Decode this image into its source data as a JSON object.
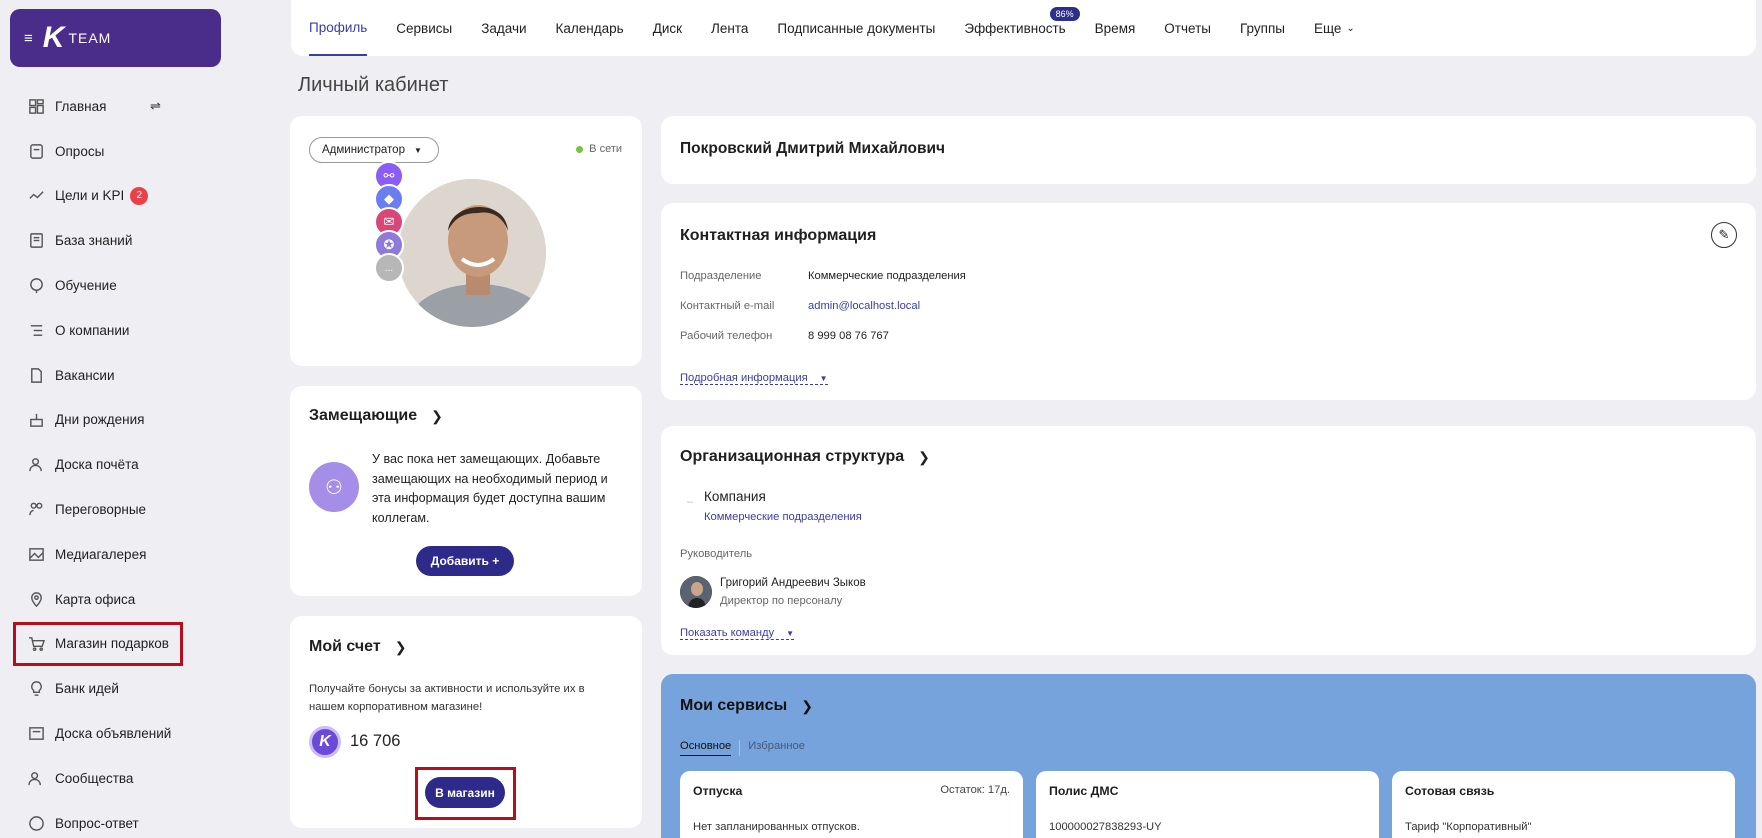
{
  "brand": {
    "text": "TEAM",
    "logo": "K"
  },
  "sidebar": {
    "items": [
      {
        "label": "Главная",
        "icon": "dashboard-icon"
      },
      {
        "label": "Опросы",
        "icon": "survey-icon"
      },
      {
        "label": "Цели и KPI",
        "icon": "kpi-icon",
        "badge": "2"
      },
      {
        "label": "База знаний",
        "icon": "book-icon"
      },
      {
        "label": "Обучение",
        "icon": "education-icon"
      },
      {
        "label": "О компании",
        "icon": "company-icon"
      },
      {
        "label": "Вакансии",
        "icon": "vacancy-icon"
      },
      {
        "label": "Дни рождения",
        "icon": "birthday-icon"
      },
      {
        "label": "Доска почёта",
        "icon": "honor-board-icon"
      },
      {
        "label": "Переговорные",
        "icon": "meeting-room-icon"
      },
      {
        "label": "Медиагалерея",
        "icon": "gallery-icon"
      },
      {
        "label": "Карта офиса",
        "icon": "map-pin-icon"
      },
      {
        "label": "Магазин подарков",
        "icon": "cart-icon"
      },
      {
        "label": "Банк идей",
        "icon": "lightbulb-icon"
      },
      {
        "label": "Доска объявлений",
        "icon": "announcement-icon"
      },
      {
        "label": "Сообщества",
        "icon": "community-icon"
      },
      {
        "label": "Вопрос-ответ",
        "icon": "faq-icon"
      }
    ]
  },
  "topnav": {
    "tabs": [
      "Профиль",
      "Сервисы",
      "Задачи",
      "Календарь",
      "Диск",
      "Лента",
      "Подписанные документы",
      "Эффективность",
      "Время",
      "Отчеты",
      "Группы",
      "Еще"
    ],
    "efficiency_badge": "86%"
  },
  "page_title": "Личный кабинет",
  "profile": {
    "role": "Администратор",
    "status": "В сети",
    "more": "..."
  },
  "name": "Покровский Дмитрий Михайлович",
  "contact": {
    "title": "Контактная информация",
    "rows": [
      {
        "label": "Подразделение",
        "value": "Коммерческие подразделения"
      },
      {
        "label": "Контактный e-mail",
        "value": "admin@localhost.local"
      },
      {
        "label": "Рабочий телефон",
        "value": "8 999 08 76 767"
      }
    ],
    "more": "Подробная информация"
  },
  "substitutes": {
    "title": "Замещающие",
    "text": "У вас пока нет замещающих. Добавьте замещающих на необходимый период и эта информация будет доступна вашим коллегам.",
    "button": "Добавить  +"
  },
  "account": {
    "title": "Мой счет",
    "text": "Получайте бонусы за активности и используйте их в нашем корпоративном магазине!",
    "balance": "16 706",
    "button": "В магазин",
    "coin": "K"
  },
  "org": {
    "title": "Организационная структура",
    "company": "Компания",
    "dept": "Коммерческие подразделения",
    "manager_label": "Руководитель",
    "manager_name": "Григорий Андреевич Зыков",
    "manager_pos": "Директор по персоналу",
    "show_team": "Показать команду"
  },
  "services": {
    "title": "Мои сервисы",
    "tabs": [
      "Основное",
      "Избранное"
    ],
    "boxes": [
      {
        "title": "Отпуска",
        "right": "Остаток: 17д.",
        "desc": "Нет запланированных отпусков."
      },
      {
        "title": "Полис ДМС",
        "right": "",
        "desc": "100000027838293-UY"
      },
      {
        "title": "Сотовая связь",
        "right": "",
        "desc": "Тариф \"Корпоративный\""
      }
    ]
  }
}
